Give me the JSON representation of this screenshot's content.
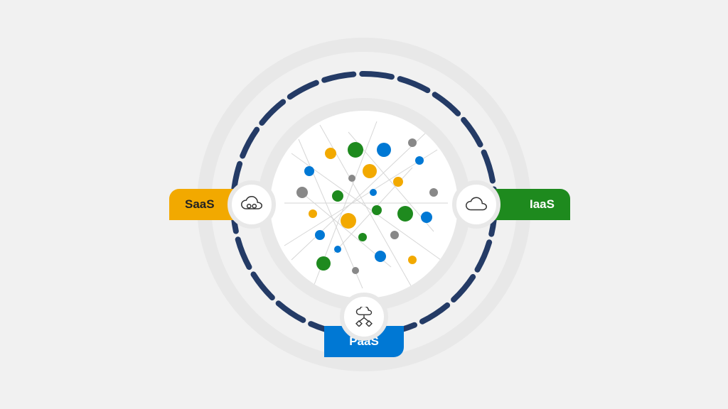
{
  "diagram": {
    "type": "radial-cloud-service-models",
    "center": {
      "description": "network-mesh-cluster",
      "node_colors": [
        "#1e8a1e",
        "#f2a900",
        "#0078d4",
        "#888888"
      ]
    },
    "rings": {
      "outer_color": "#e8e8e8",
      "inner_color": "#e8e8e8",
      "dashed_color": "#243b66"
    },
    "models": [
      {
        "key": "saas",
        "label": "SaaS",
        "position": "left",
        "color": "#f2a900",
        "text_color": "#222222",
        "icon": "cloud-gears-icon"
      },
      {
        "key": "iaas",
        "label": "IaaS",
        "position": "right",
        "color": "#1e8a1e",
        "text_color": "#ffffff",
        "icon": "cloud-icon"
      },
      {
        "key": "paas",
        "label": "PaaS",
        "position": "bottom",
        "color": "#0078d4",
        "text_color": "#ffffff",
        "icon": "cloud-hierarchy-icon"
      }
    ]
  }
}
